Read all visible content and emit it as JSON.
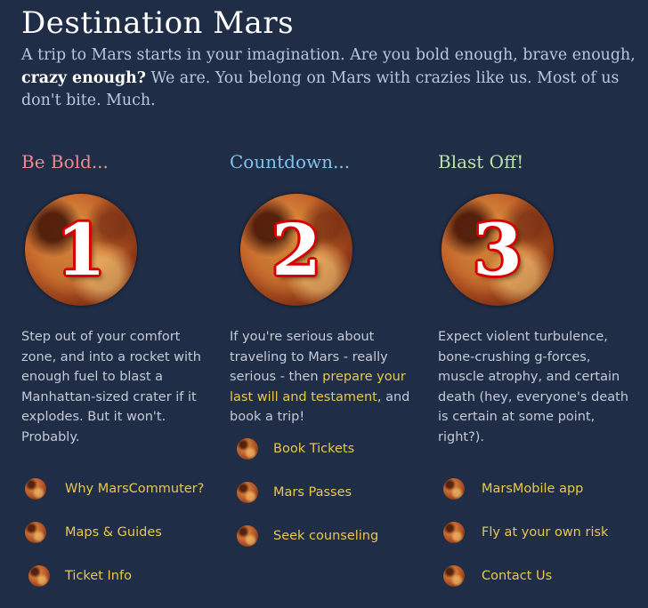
{
  "title": "Destination Mars",
  "intro": {
    "before": "A trip to Mars starts in your imagination. Are you bold enough, brave enough, ",
    "emphasis": "crazy enough?",
    "after": " We are. You belong on Mars with crazies like us. Most of us don't bite. Much."
  },
  "columns": [
    {
      "heading": "Be Bold...",
      "heading_color": "#f08a8a",
      "number": "1",
      "text": "Step out of your comfort zone, and into a rocket with enough fuel to blast a Manhattan-sized crater if it explodes. But it won't. Probably.",
      "links": [
        "Why MarsCommuter?",
        "Maps & Guides",
        "Ticket Info"
      ]
    },
    {
      "heading": "Countdown...",
      "heading_color": "#7ec3ec",
      "number": "2",
      "text_before": "If you're serious about traveling to Mars - really serious - then ",
      "text_link": "prepare your last will and testament",
      "text_after": ", and book a trip!",
      "links": [
        "Book Tickets",
        "Mars Passes",
        "Seek counseling"
      ]
    },
    {
      "heading": "Blast Off!",
      "heading_color": "#b9e3a8",
      "number": "3",
      "text": "Expect violent turbulence, bone-crushing g-forces, muscle atrophy, and certain death (hey, everyone's death is certain at some point, right?).",
      "links": [
        "MarsMobile app",
        "Fly at your own risk",
        "Contact Us"
      ]
    }
  ],
  "colors": {
    "background": "#1f2d47",
    "link": "#e8c84a",
    "body_text": "#c4cad6",
    "planet_number_outline": "#d80000"
  },
  "icons": {
    "planet": "mars-planet-icon"
  }
}
